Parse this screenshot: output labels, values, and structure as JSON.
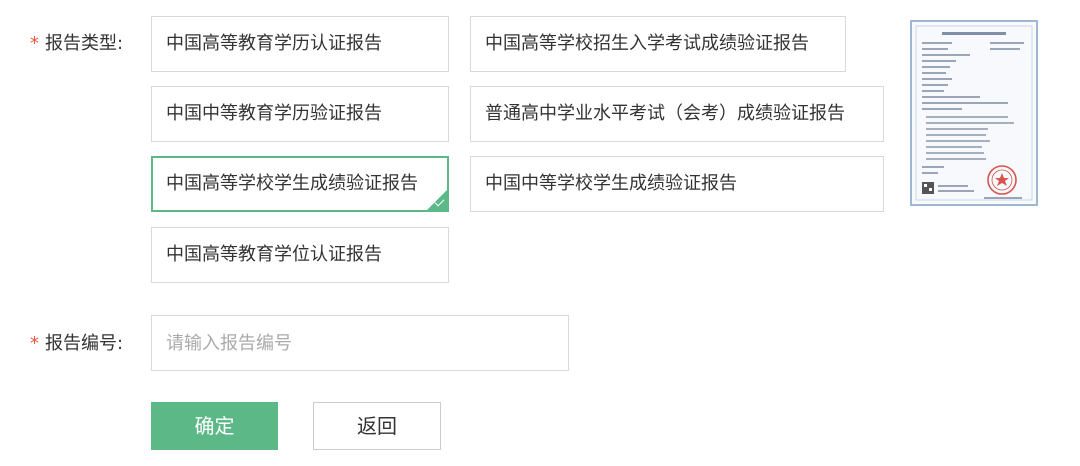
{
  "report_type": {
    "required_mark": "*",
    "label": "报告类型:",
    "options": [
      {
        "label": "中国高等教育学历认证报告",
        "selected": false
      },
      {
        "label": "中国高等学校招生入学考试成绩验证报告",
        "selected": false
      },
      {
        "label": "中国中等教育学历验证报告",
        "selected": false
      },
      {
        "label": "普通高中学业水平考试（会考）成绩验证报告",
        "selected": false
      },
      {
        "label": "中国高等学校学生成绩验证报告",
        "selected": true
      },
      {
        "label": "中国中等学校学生成绩验证报告",
        "selected": false
      },
      {
        "label": "中国高等教育学位认证报告",
        "selected": false
      }
    ]
  },
  "report_number": {
    "required_mark": "*",
    "label": "报告编号:",
    "value": "",
    "placeholder": "请输入报告编号"
  },
  "buttons": {
    "confirm": "确定",
    "back": "返回"
  },
  "colors": {
    "accent": "#5cb887",
    "required": "#e9573f",
    "border": "#d9d9d9"
  },
  "icons": {
    "selected_corner": "check-icon"
  }
}
